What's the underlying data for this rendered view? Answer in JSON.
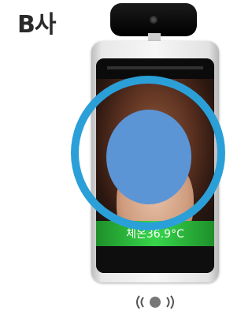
{
  "label": "B사",
  "device": {
    "temperature_display": "체온36.9°C",
    "nfc_symbol": "((🄰))"
  },
  "colors": {
    "ring": "#2b9fd8",
    "face_blur": "#5b95d6",
    "temperature_bar": "#37d64a"
  },
  "icons": {
    "camera": "camera-icon",
    "nfc": "nfc-icon"
  }
}
